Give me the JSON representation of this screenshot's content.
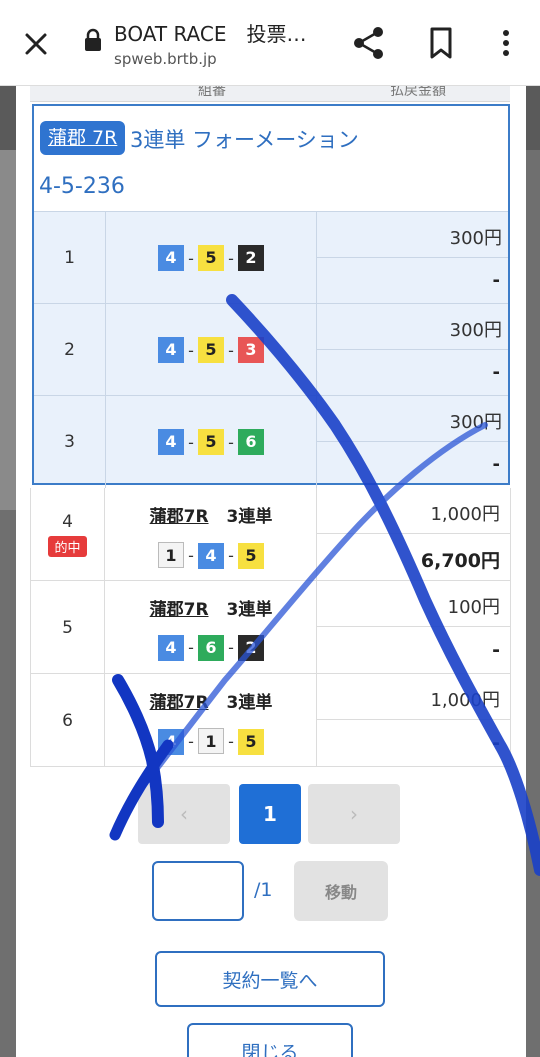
{
  "browser": {
    "title": "BOAT RACE　投票…",
    "url": "spweb.brtb.jp",
    "icons": [
      "close-icon",
      "lock-icon",
      "share-icon",
      "bookmark-icon",
      "more-vert-icon"
    ]
  },
  "table": {
    "headers": [
      "組番",
      "払戻金額"
    ]
  },
  "selected_bet": {
    "place_race": "蒲郡 7R",
    "bet_type": "3連単 フォーメーション",
    "formation": "4-5-236",
    "rows": [
      {
        "no": "1",
        "boats": [
          "4",
          "5",
          "2"
        ],
        "amount": "300円",
        "payout": "-"
      },
      {
        "no": "2",
        "boats": [
          "4",
          "5",
          "3"
        ],
        "amount": "300円",
        "payout": "-"
      },
      {
        "no": "3",
        "boats": [
          "4",
          "5",
          "6"
        ],
        "amount": "300円",
        "payout": "-"
      }
    ]
  },
  "other_bets": [
    {
      "no": "4",
      "badge": "的中",
      "place": "蒲郡7R",
      "type": "3連単",
      "boats": [
        "1",
        "4",
        "5"
      ],
      "amount": "1,000円",
      "payout": "6,700円"
    },
    {
      "no": "5",
      "badge": "",
      "place": "蒲郡7R",
      "type": "3連単",
      "boats": [
        "4",
        "6",
        "2"
      ],
      "amount": "100円",
      "payout": "-"
    },
    {
      "no": "6",
      "badge": "",
      "place": "蒲郡7R",
      "type": "3連単",
      "boats": [
        "4",
        "1",
        "5"
      ],
      "amount": "1,000円",
      "payout": "-"
    }
  ],
  "pagination": {
    "prev": "‹",
    "current": "1",
    "next": "›",
    "input_value": "",
    "total": "/1",
    "move_label": "移動"
  },
  "actions": {
    "list_label": "契約一覧へ",
    "close_label": "閉じる"
  },
  "colors": {
    "accent": "#2f74d0",
    "selected_bg": "#e9f1fb",
    "hit_badge": "#e63b3b",
    "boat_colors": {
      "1": "#f4f4f4",
      "2": "#2a2a2a",
      "3": "#e85656",
      "4": "#4a8be2",
      "5": "#f7e040",
      "6": "#2eab5c"
    }
  }
}
